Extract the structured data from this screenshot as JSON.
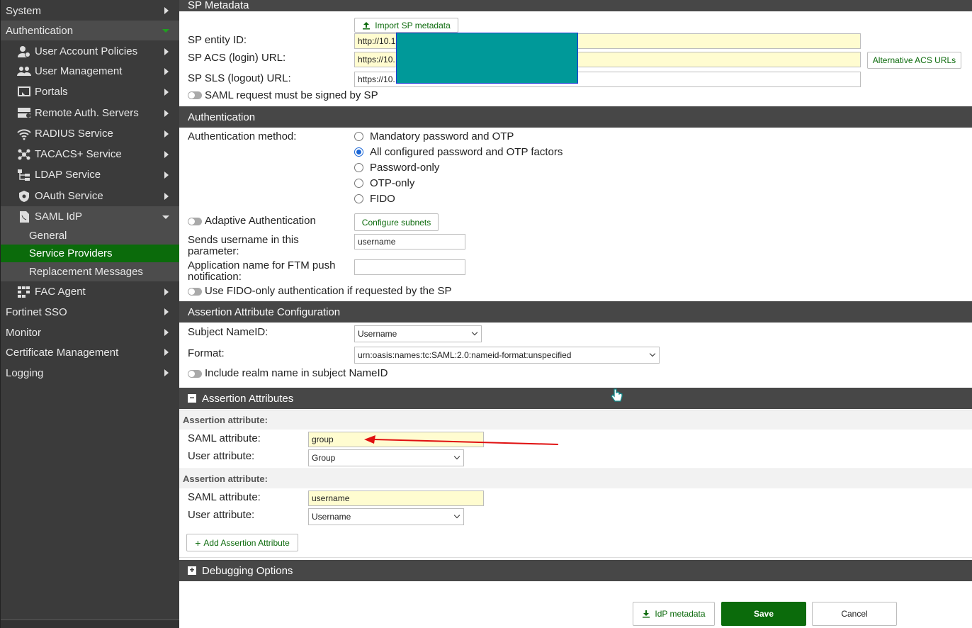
{
  "sidebar": {
    "system": "System",
    "authentication": "Authentication",
    "user_account_policies": "User Account Policies",
    "user_management": "User Management",
    "portals": "Portals",
    "remote_auth_servers": "Remote Auth. Servers",
    "radius_service": "RADIUS Service",
    "tacacs_service": "TACACS+ Service",
    "ldap_service": "LDAP Service",
    "oauth_service": "OAuth Service",
    "saml_idp": "SAML IdP",
    "general": "General",
    "service_providers": "Service Providers",
    "replacement_messages": "Replacement Messages",
    "fac_agent": "FAC Agent",
    "fortinet_sso": "Fortinet SSO",
    "monitor": "Monitor",
    "certificate_management": "Certificate Management",
    "logging": "Logging"
  },
  "sp_metadata": {
    "title": "SP Metadata",
    "import_button": "Import SP metadata",
    "entity_id_label": "SP entity ID:",
    "entity_id_value": "http://10.1",
    "acs_label": "SP ACS (login) URL:",
    "acs_value": "https://10.",
    "alt_acs_button": "Alternative ACS URLs",
    "sls_label": "SP SLS (logout) URL:",
    "sls_value": "https://10.",
    "signed_label": "SAML request must be signed by SP"
  },
  "authentication": {
    "title": "Authentication",
    "method_label": "Authentication method:",
    "options": [
      "Mandatory password and OTP",
      "All configured password and OTP factors",
      "Password-only",
      "OTP-only",
      "FIDO"
    ],
    "adaptive_label": "Adaptive Authentication",
    "configure_subnets_button": "Configure subnets",
    "sends_username_label": "Sends username in this parameter:",
    "sends_username_value": "username",
    "app_name_label": "Application name for FTM push notification:",
    "app_name_value": "",
    "fido_only_label": "Use FIDO-only authentication if requested by the SP"
  },
  "assertion_config": {
    "title": "Assertion Attribute Configuration",
    "subject_label": "Subject NameID:",
    "subject_value": "Username",
    "format_label": "Format:",
    "format_value": "urn:oasis:names:tc:SAML:2.0:nameid-format:unspecified",
    "include_realm_label": "Include realm name in subject NameID"
  },
  "assertion_attributes": {
    "title": "Assertion Attributes",
    "collapse_symbol": "−",
    "items": [
      {
        "heading": "Assertion attribute:",
        "saml_label": "SAML attribute:",
        "saml_value": "group",
        "user_label": "User attribute:",
        "user_value": "Group"
      },
      {
        "heading": "Assertion attribute:",
        "saml_label": "SAML attribute:",
        "saml_value": "username",
        "user_label": "User attribute:",
        "user_value": "Username"
      }
    ],
    "add_button": "Add Assertion Attribute"
  },
  "debugging": {
    "title": "Debugging Options",
    "expand_symbol": "+"
  },
  "footer": {
    "idp_metadata_button": "IdP metadata",
    "save_button": "Save",
    "cancel_button": "Cancel"
  },
  "colors": {
    "sidebar_bg": "#3b3b3b",
    "section_bar": "#474747",
    "accent_green": "#0b6b0b",
    "input_highlight": "#fffcd0",
    "redaction": "#009999",
    "annotation_arrow": "#e01010"
  }
}
